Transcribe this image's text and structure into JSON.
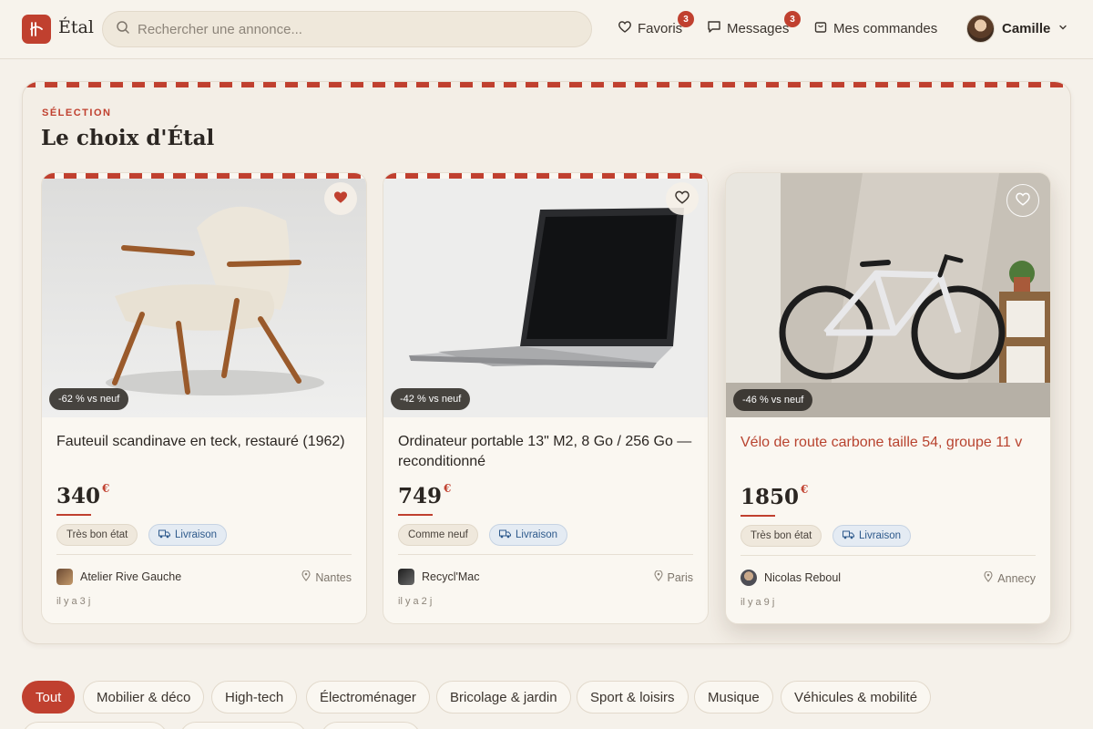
{
  "header": {
    "brand": "Étal",
    "search_placeholder": "Rechercher une annonce...",
    "nav": {
      "favorites": {
        "label": "Favoris",
        "badge": "3"
      },
      "messages": {
        "label": "Messages",
        "badge": "3"
      },
      "orders": {
        "label": "Mes commandes"
      }
    },
    "user": {
      "name": "Camille"
    }
  },
  "selection": {
    "kicker": "SÉLECTION",
    "title": "Le choix d'Étal",
    "cards": [
      {
        "title": "Fauteuil scandinave en teck, restauré (1962)",
        "price": "340",
        "currency": "€",
        "discount": "-62 % vs neuf",
        "condition": "Très bon état",
        "shipping": "Livraison",
        "seller": "Atelier Rive Gauche",
        "location": "Nantes",
        "posted": "il y a 3 j",
        "favorited": true
      },
      {
        "title": "Ordinateur portable 13\" M2, 8 Go / 256 Go — reconditionné",
        "price": "749",
        "currency": "€",
        "discount": "-42 % vs neuf",
        "condition": "Comme neuf",
        "shipping": "Livraison",
        "seller": "Recycl'Mac",
        "location": "Paris",
        "posted": "il y a 2 j",
        "favorited": false
      },
      {
        "title": "Vélo de route carbone taille 54, groupe 11 v",
        "price": "1850",
        "currency": "€",
        "discount": "-46 % vs neuf",
        "condition": "Très bon état",
        "shipping": "Livraison",
        "seller": "Nicolas Reboul",
        "location": "Annecy",
        "posted": "il y a 9 j",
        "favorited": false
      }
    ]
  },
  "categories": [
    {
      "label": "Tout",
      "active": true
    },
    {
      "label": "Mobilier & déco"
    },
    {
      "label": "High-tech"
    },
    {
      "label": "Électroménager"
    },
    {
      "label": "Bricolage & jardin"
    },
    {
      "label": "Sport & loisirs"
    },
    {
      "label": "Musique"
    },
    {
      "label": "Véhicules & mobilité"
    }
  ],
  "colors": {
    "accent": "#c0402f",
    "background": "#f5f1ea",
    "card": "#faf7f1",
    "shipping_chip": "#e4ebf3"
  }
}
